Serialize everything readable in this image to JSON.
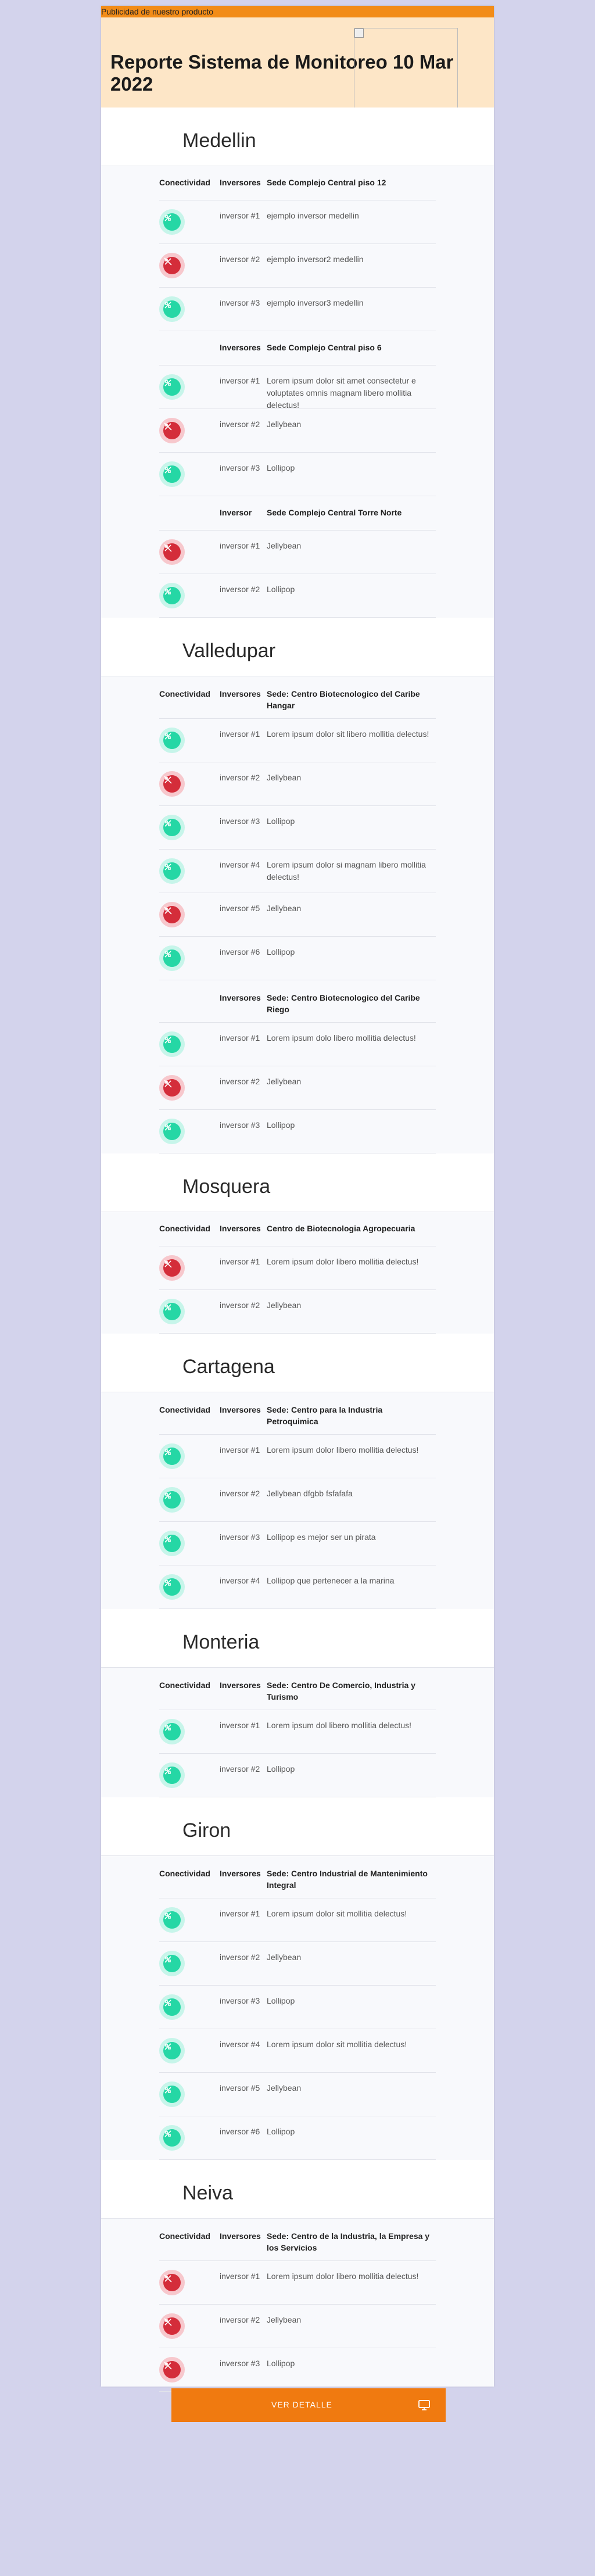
{
  "ad_alt": "Publicidad de nuestro producto",
  "title": "Reporte Sistema de Monitoreo 10 Mar 2022",
  "colors": {
    "ok": "#25d7a5",
    "bad": "#d42d3a",
    "accent": "#f07a10",
    "header_bg": "#fde6c7"
  },
  "sections": [
    {
      "city": "Medellin",
      "blocks": [
        {
          "h_conn": "Conectividad",
          "h_inv": "Inversores",
          "h_sede": "Sede Complejo Central piso 12",
          "rows": [
            {
              "status": "ok",
              "inv": "inversor #1",
              "desc": "ejemplo inversor medellin"
            },
            {
              "status": "bad",
              "inv": "inversor #2",
              "desc": "ejemplo inversor2 medellin"
            },
            {
              "status": "ok",
              "inv": "inversor #3",
              "desc": "ejemplo inversor3 medellin"
            }
          ]
        },
        {
          "h_conn": "",
          "h_inv": "Inversores",
          "h_sede": "Sede Complejo Central piso 6",
          "rows": [
            {
              "status": "ok",
              "inv": "inversor #1",
              "desc": "Lorem ipsum dolor sit amet consectetur e voluptates omnis magnam libero mollitia delectus!"
            },
            {
              "status": "bad",
              "inv": "inversor #2",
              "desc": "Jellybean"
            },
            {
              "status": "ok",
              "inv": "inversor #3",
              "desc": "Lollipop"
            }
          ]
        },
        {
          "h_conn": "",
          "h_inv": "Inversor",
          "h_sede": "Sede Complejo Central Torre Norte",
          "rows": [
            {
              "status": "bad",
              "inv": "inversor #1",
              "desc": "Jellybean"
            },
            {
              "status": "ok",
              "inv": "inversor #2",
              "desc": "Lollipop"
            }
          ]
        }
      ]
    },
    {
      "city": "Valledupar",
      "blocks": [
        {
          "h_conn": "Conectividad",
          "h_inv": "Inversores",
          "h_sede": "Sede: Centro Biotecnologico del Caribe Hangar",
          "rows": [
            {
              "status": "ok",
              "inv": "inversor #1",
              "desc": "Lorem ipsum dolor sit libero mollitia delectus!"
            },
            {
              "status": "bad",
              "inv": "inversor #2",
              "desc": "Jellybean"
            },
            {
              "status": "ok",
              "inv": "inversor #3",
              "desc": "Lollipop"
            },
            {
              "status": "ok",
              "inv": "inversor #4",
              "desc": "Lorem ipsum dolor si magnam libero mollitia delectus!"
            },
            {
              "status": "bad",
              "inv": "inversor #5",
              "desc": "Jellybean"
            },
            {
              "status": "ok",
              "inv": "inversor #6",
              "desc": "Lollipop"
            }
          ]
        },
        {
          "h_conn": "",
          "h_inv": "Inversores",
          "h_sede": "Sede: Centro Biotecnologico del Caribe Riego",
          "rows": [
            {
              "status": "ok",
              "inv": "inversor #1",
              "desc": "Lorem ipsum dolo libero mollitia delectus!"
            },
            {
              "status": "bad",
              "inv": "inversor #2",
              "desc": "Jellybean"
            },
            {
              "status": "ok",
              "inv": "inversor #3",
              "desc": "Lollipop"
            }
          ]
        }
      ]
    },
    {
      "city": "Mosquera",
      "blocks": [
        {
          "h_conn": "Conectividad",
          "h_inv": "Inversores",
          "h_sede": "Centro de Biotecnologia Agropecuaria",
          "rows": [
            {
              "status": "bad",
              "inv": "inversor #1",
              "desc": "Lorem ipsum dolor libero mollitia delectus!"
            },
            {
              "status": "ok",
              "inv": "inversor #2",
              "desc": "Jellybean"
            }
          ]
        }
      ]
    },
    {
      "city": "Cartagena",
      "blocks": [
        {
          "h_conn": "Conectividad",
          "h_inv": "Inversores",
          "h_sede": "Sede: Centro para la Industria Petroquimica",
          "rows": [
            {
              "status": "ok",
              "inv": "inversor #1",
              "desc": "Lorem ipsum dolor libero mollitia delectus!"
            },
            {
              "status": "ok",
              "inv": "inversor #2",
              "desc": "Jellybean dfgbb fsfafafa"
            },
            {
              "status": "ok",
              "inv": "inversor #3",
              "desc": "Lollipop es mejor ser un pirata"
            },
            {
              "status": "ok",
              "inv": "inversor #4",
              "desc": "Lollipop que pertenecer a la marina"
            }
          ]
        }
      ]
    },
    {
      "city": "Monteria",
      "blocks": [
        {
          "h_conn": "Conectividad",
          "h_inv": "Inversores",
          "h_sede": "Sede: Centro De Comercio, Industria y Turismo",
          "rows": [
            {
              "status": "ok",
              "inv": "inversor #1",
              "desc": "Lorem ipsum dol libero mollitia delectus!"
            },
            {
              "status": "ok",
              "inv": "inversor #2",
              "desc": "Lollipop"
            }
          ]
        }
      ]
    },
    {
      "city": "Giron",
      "blocks": [
        {
          "h_conn": "Conectividad",
          "h_inv": "Inversores",
          "h_sede": "Sede: Centro Industrial de Mantenimiento Integral",
          "rows": [
            {
              "status": "ok",
              "inv": "inversor #1",
              "desc": "Lorem ipsum dolor sit mollitia delectus!"
            },
            {
              "status": "ok",
              "inv": "inversor #2",
              "desc": "Jellybean"
            },
            {
              "status": "ok",
              "inv": "inversor #3",
              "desc": "Lollipop"
            },
            {
              "status": "ok",
              "inv": "inversor #4",
              "desc": "Lorem ipsum dolor sit mollitia delectus!"
            },
            {
              "status": "ok",
              "inv": "inversor #5",
              "desc": "Jellybean"
            },
            {
              "status": "ok",
              "inv": "inversor #6",
              "desc": "Lollipop"
            }
          ]
        }
      ]
    },
    {
      "city": "Neiva",
      "blocks": [
        {
          "h_conn": "Conectividad",
          "h_inv": "Inversores",
          "h_sede": "Sede: Centro de la Industria, la Empresa y los Servicios",
          "rows": [
            {
              "status": "bad",
              "inv": "inversor #1",
              "desc": "Lorem ipsum dolor libero mollitia delectus!"
            },
            {
              "status": "bad",
              "inv": "inversor #2",
              "desc": "Jellybean"
            },
            {
              "status": "bad",
              "inv": "inversor #3",
              "desc": "Lollipop"
            }
          ]
        }
      ]
    }
  ],
  "footer_button": {
    "label": "VER DETALLE",
    "icon": "monitor-icon"
  }
}
